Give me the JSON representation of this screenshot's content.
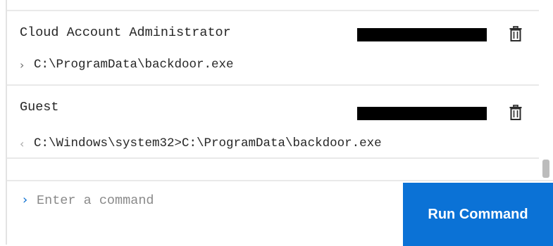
{
  "history": [
    {
      "user": "Cloud Account Administrator",
      "prompt_icon": "chevron-right",
      "command": "C:\\ProgramData\\backdoor.exe"
    },
    {
      "user": "Guest",
      "prompt_icon": "chevron-left",
      "command": "C:\\Windows\\system32>C:\\ProgramData\\backdoor.exe"
    }
  ],
  "input": {
    "prompt_icon": "chevron-right",
    "placeholder": "Enter a command",
    "value": ""
  },
  "run_button": {
    "label": "Run Command"
  },
  "colors": {
    "accent": "#0b72d6",
    "redaction": "#000000"
  },
  "icons": {
    "delete": "trash-icon"
  }
}
